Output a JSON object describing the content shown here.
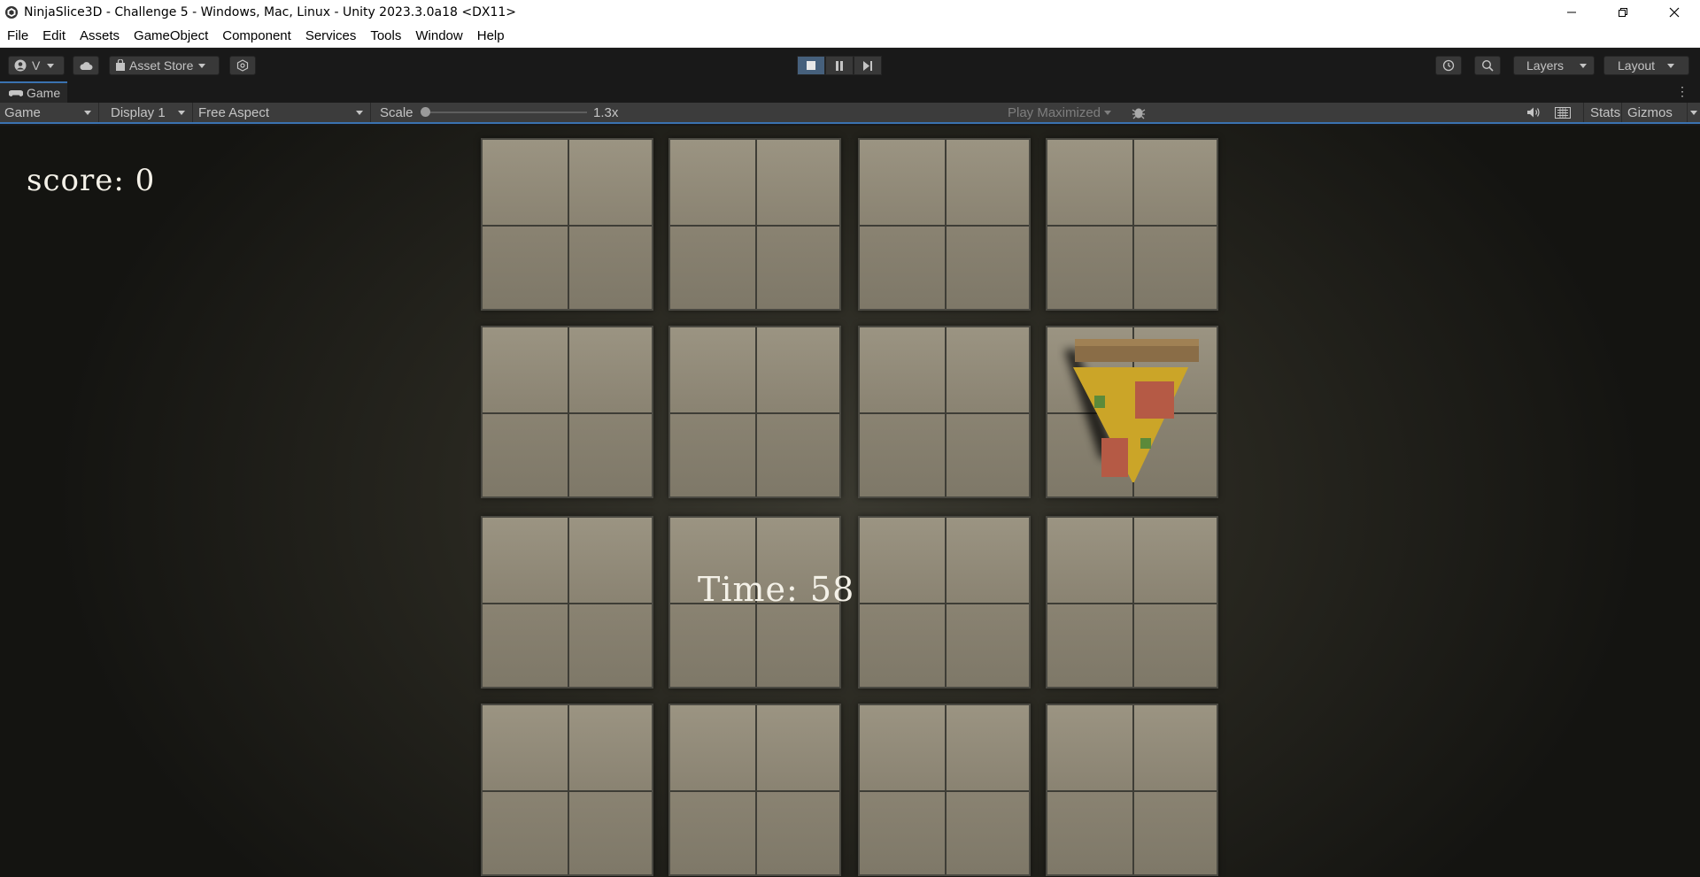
{
  "window": {
    "title": "NinjaSlice3D - Challenge 5 - Windows, Mac, Linux - Unity 2023.3.0a18 <DX11>"
  },
  "menu": {
    "items": [
      "File",
      "Edit",
      "Assets",
      "GameObject",
      "Component",
      "Services",
      "Tools",
      "Window",
      "Help"
    ]
  },
  "toolbar": {
    "account_label": "V",
    "asset_store_label": "Asset Store",
    "layers_label": "Layers",
    "layout_label": "Layout"
  },
  "game_tab": {
    "label": "Game"
  },
  "game_toolbar": {
    "view_mode": "Game",
    "display": "Display 1",
    "aspect": "Free Aspect",
    "scale_label": "Scale",
    "scale_value": "1.3x",
    "play_mode": "Play Maximized",
    "stats_label": "Stats",
    "gizmos_label": "Gizmos"
  },
  "game": {
    "score_text": "score: 0",
    "time_text": "Time: 58"
  },
  "colors": {
    "accent": "#3a72b0",
    "tile": "#8a8372",
    "hud_text": "#f4f1e8"
  }
}
